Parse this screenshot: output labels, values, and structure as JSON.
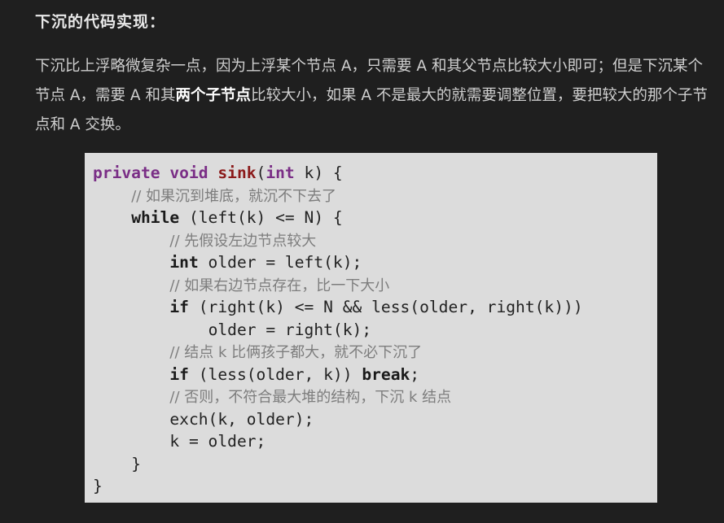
{
  "heading": "下沉的代码实现：",
  "paragraph": {
    "part1": "下沉比上浮略微复杂一点，因为上浮某个节点 A，只需要 A 和其父节点比较大小即可；但是下沉某个节点 A，需要 A 和其",
    "bold": "两个子节点",
    "part2": "比较大小，如果 A 不是最大的就需要调整位置，要把较大的那个子节点和 A 交换。"
  },
  "code": {
    "l1_kw1": "private",
    "l1_kw2": "void",
    "l1_fn": "sink",
    "l1_open": "(",
    "l1_kw3": "int",
    "l1_rest": " k) {",
    "l2_comment": "// 如果沉到堆底，就沉不下去了",
    "l3_kw": "while",
    "l3_rest": " (left(k) <= N) {",
    "l4_comment": "// 先假设左边节点较大",
    "l5_kw": "int",
    "l5_rest": " older = left(k);",
    "l6_comment": "// 如果右边节点存在，比一下大小",
    "l7_kw": "if",
    "l7_rest": " (right(k) <= N && less(older, right(k)))",
    "l8": "older = right(k);",
    "l9_comment": "// 结点 k 比俩孩子都大，就不必下沉了",
    "l10_kw": "if",
    "l10_mid": " (less(older, k)) ",
    "l10_kw2": "break",
    "l10_end": ";",
    "l11_comment": "// 否则，不符合最大堆的结构，下沉 k 结点",
    "l12": "exch(k, older);",
    "l13": "k = older;",
    "l14": "}",
    "l15": "}"
  }
}
